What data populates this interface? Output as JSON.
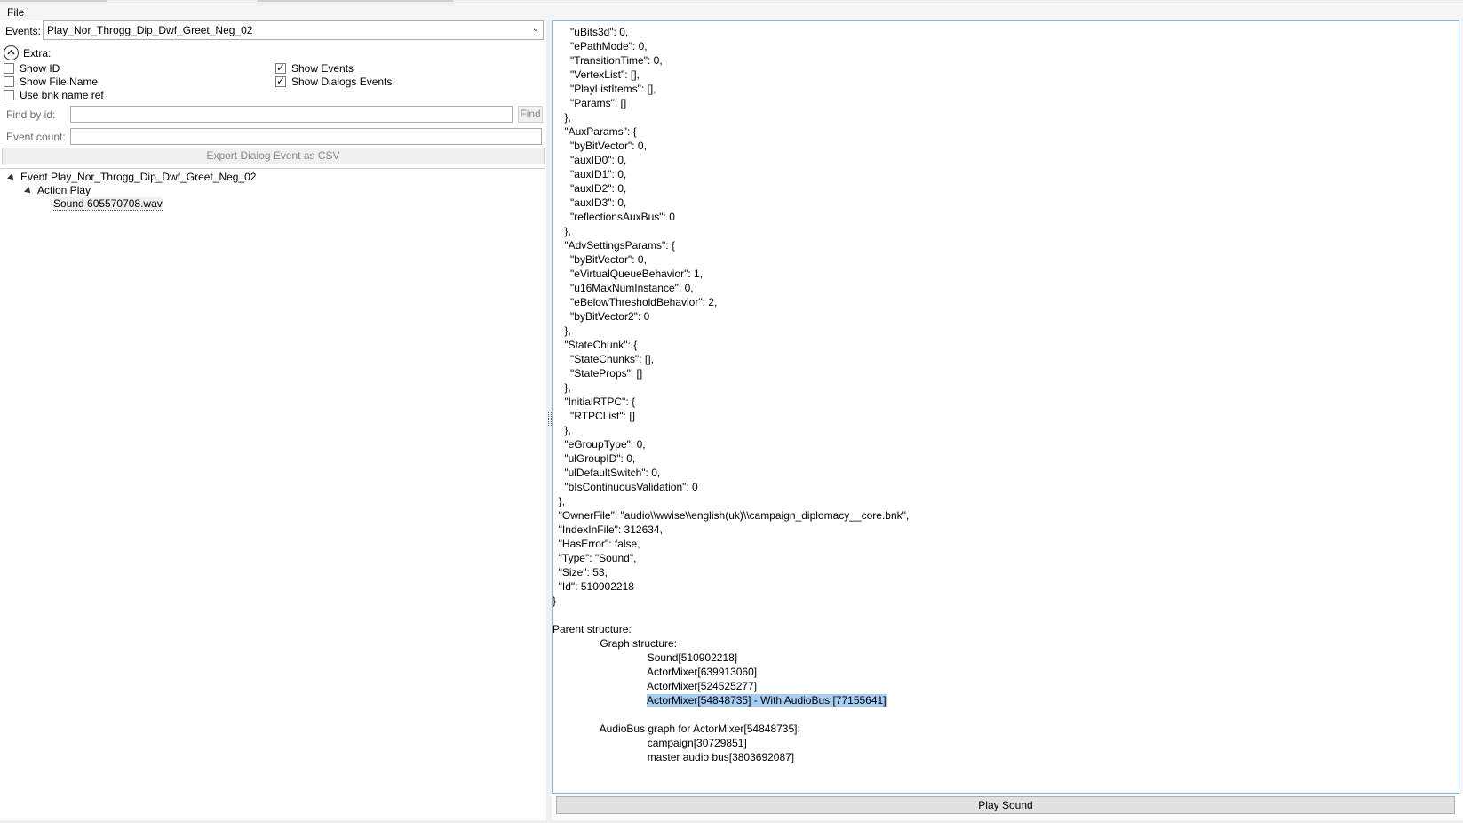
{
  "menu": {
    "file": "File"
  },
  "left": {
    "events_label": "Events:",
    "events_value": "Play_Nor_Throgg_Dip_Dwf_Greet_Neg_02",
    "extra_label": "Extra:",
    "options": [
      {
        "label": "Show ID",
        "checked": false
      },
      {
        "label": "Show File Name",
        "checked": false
      },
      {
        "label": "Use bnk name ref",
        "checked": false
      },
      {
        "label": "Show Events",
        "checked": true
      },
      {
        "label": "Show Dialogs Events",
        "checked": true
      }
    ],
    "find_label": "Find by id:",
    "find_button": "Find",
    "count_label": "Event count:",
    "export_button": "Export Dialog Event as CSV",
    "tree": {
      "event": "Event Play_Nor_Throgg_Dip_Dwf_Greet_Neg_02",
      "action": "Action Play",
      "sound": "Sound 605570708.wav"
    }
  },
  "right": {
    "lines": [
      "      \"uBits3d\": 0,",
      "      \"ePathMode\": 0,",
      "      \"TransitionTime\": 0,",
      "      \"VertexList\": [],",
      "      \"PlayListItems\": [],",
      "      \"Params\": []",
      "    },",
      "    \"AuxParams\": {",
      "      \"byBitVector\": 0,",
      "      \"auxID0\": 0,",
      "      \"auxID1\": 0,",
      "      \"auxID2\": 0,",
      "      \"auxID3\": 0,",
      "      \"reflectionsAuxBus\": 0",
      "    },",
      "    \"AdvSettingsParams\": {",
      "      \"byBitVector\": 0,",
      "      \"eVirtualQueueBehavior\": 1,",
      "      \"u16MaxNumInstance\": 0,",
      "      \"eBelowThresholdBehavior\": 2,",
      "      \"byBitVector2\": 0",
      "    },",
      "    \"StateChunk\": {",
      "      \"StateChunks\": [],",
      "      \"StateProps\": []",
      "    },",
      "    \"InitialRTPC\": {",
      "      \"RTPCList\": []",
      "    },",
      "    \"eGroupType\": 0,",
      "    \"ulGroupID\": 0,",
      "    \"ulDefaultSwitch\": 0,",
      "    \"bIsContinuousValidation\": 0",
      "  },",
      "  \"OwnerFile\": \"audio\\\\wwise\\\\english(uk)\\\\campaign_diplomacy__core.bnk\",",
      "  \"IndexInFile\": 312634,",
      "  \"HasError\": false,",
      "  \"Type\": \"Sound\",",
      "  \"Size\": 53,",
      "  \"Id\": 510902218",
      "}",
      "",
      "Parent structure:",
      "                Graph structure:",
      "                                Sound[510902218]",
      "                                ActorMixer[639913060]",
      "                                ActorMixer[524525277]",
      "                                ActorMixer[54848735] - With AudioBus [77155641]",
      "",
      "                AudioBus graph for ActorMixer[54848735]:",
      "                                campaign[30729851]",
      "                                master audio bus[3803692087]"
    ],
    "highlight_index": 47,
    "play_button": "Play Sound"
  }
}
